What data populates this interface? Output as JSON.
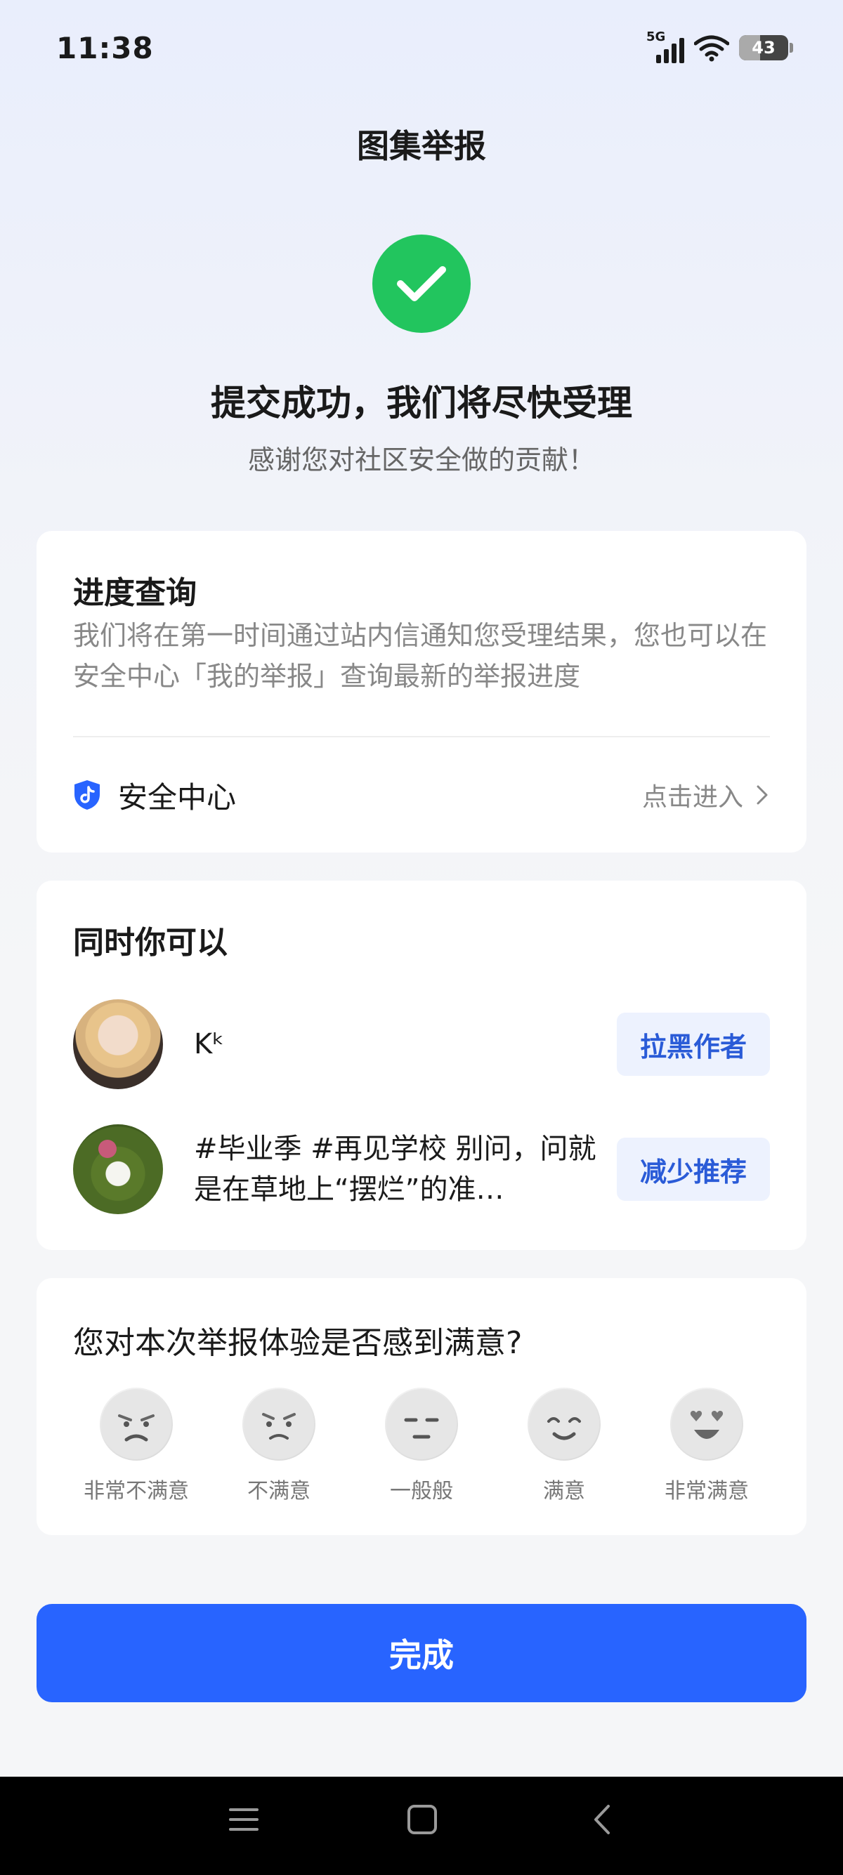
{
  "status_bar": {
    "time": "11:38",
    "network": "5G",
    "battery": "43",
    "battery_level": 0.43
  },
  "page": {
    "title": "图集举报"
  },
  "result": {
    "headline": "提交成功，我们将尽快受理",
    "subline": "感谢您对社区安全做的贡献！"
  },
  "progress_card": {
    "title": "进度查询",
    "description": "我们将在第一时间通过站内信通知您受理结果，您也可以在安全中心「我的举报」查询最新的举报进度",
    "safety_center_label": "安全中心",
    "enter_label": "点击进入"
  },
  "actions_card": {
    "title": "同时你可以",
    "items": [
      {
        "text": "Kᵏ",
        "button_label": "拉黑作者"
      },
      {
        "text": "#毕业季 #再见学校 别问，问就是在草地上“摆烂”的准…",
        "button_label": "减少推荐"
      }
    ]
  },
  "survey_card": {
    "title": "您对本次举报体验是否感到满意?",
    "options": [
      "非常不满意",
      "不满意",
      "一般般",
      "满意",
      "非常满意"
    ]
  },
  "done_button": {
    "label": "完成"
  },
  "colors": {
    "primary": "#2864ff",
    "success": "#22c55e",
    "action_text": "#2a5bd7"
  }
}
